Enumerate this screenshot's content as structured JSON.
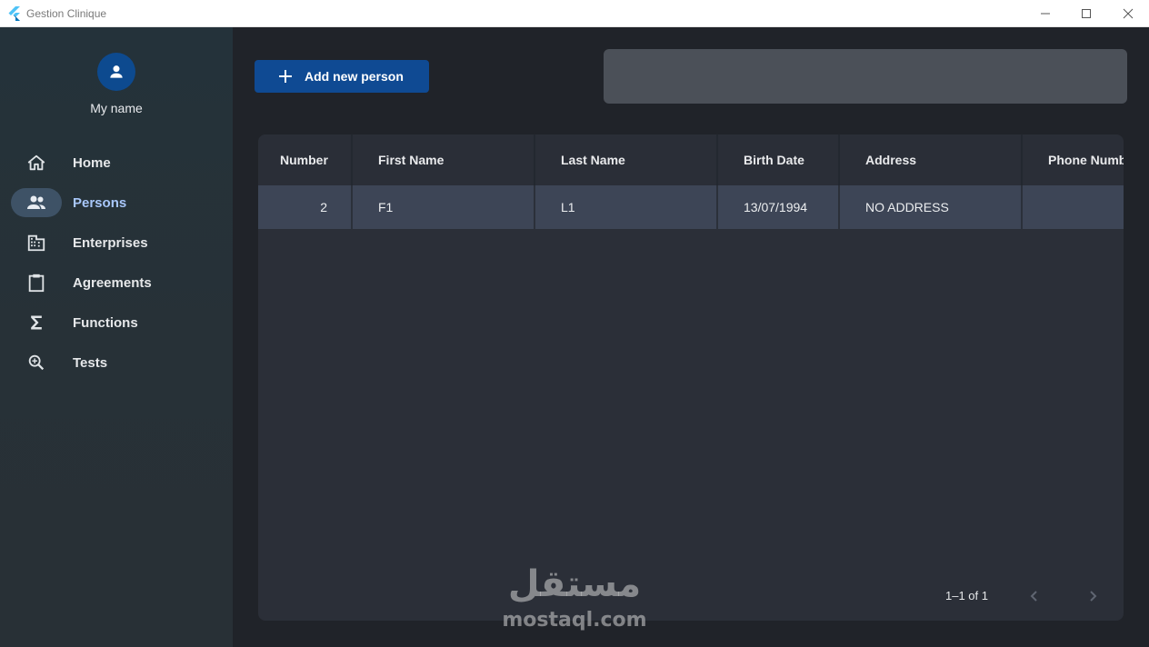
{
  "window": {
    "title": "Gestion Clinique",
    "controls": [
      "minimize-icon",
      "maximize-icon",
      "close-icon"
    ]
  },
  "colors": {
    "accent": "#0f4a93",
    "sidebar_bg": "#273137",
    "active_nav_pill": "#3e5266",
    "active_nav_text": "#a8c7fa",
    "table_row_bg": "#3d4556"
  },
  "sidebar": {
    "user_name": "My name",
    "avatar_icon": "person-icon",
    "items": [
      {
        "label": "Home",
        "icon": "home-icon",
        "active": false
      },
      {
        "label": "Persons",
        "icon": "people-icon",
        "active": true
      },
      {
        "label": "Enterprises",
        "icon": "building-icon",
        "active": false
      },
      {
        "label": "Agreements",
        "icon": "clipboard-icon",
        "active": false
      },
      {
        "label": "Functions",
        "icon": "sigma-icon",
        "active": false
      },
      {
        "label": "Tests",
        "icon": "zoom-in-icon",
        "active": false
      }
    ]
  },
  "toolbar": {
    "add_label": "Add new person",
    "search_value": ""
  },
  "table": {
    "columns": [
      "Number",
      "First Name",
      "Last Name",
      "Birth Date",
      "Address",
      "Phone Numb"
    ],
    "rows": [
      [
        "2",
        "F1",
        "L1",
        "13/07/1994",
        "NO ADDRESS",
        ""
      ]
    ]
  },
  "pagination": {
    "range_text": "1–1 of 1",
    "prev_icon": "chevron-left-icon",
    "next_icon": "chevron-right-icon"
  },
  "watermark": {
    "arabic": "مستقل",
    "latin": "mostaql.com"
  }
}
